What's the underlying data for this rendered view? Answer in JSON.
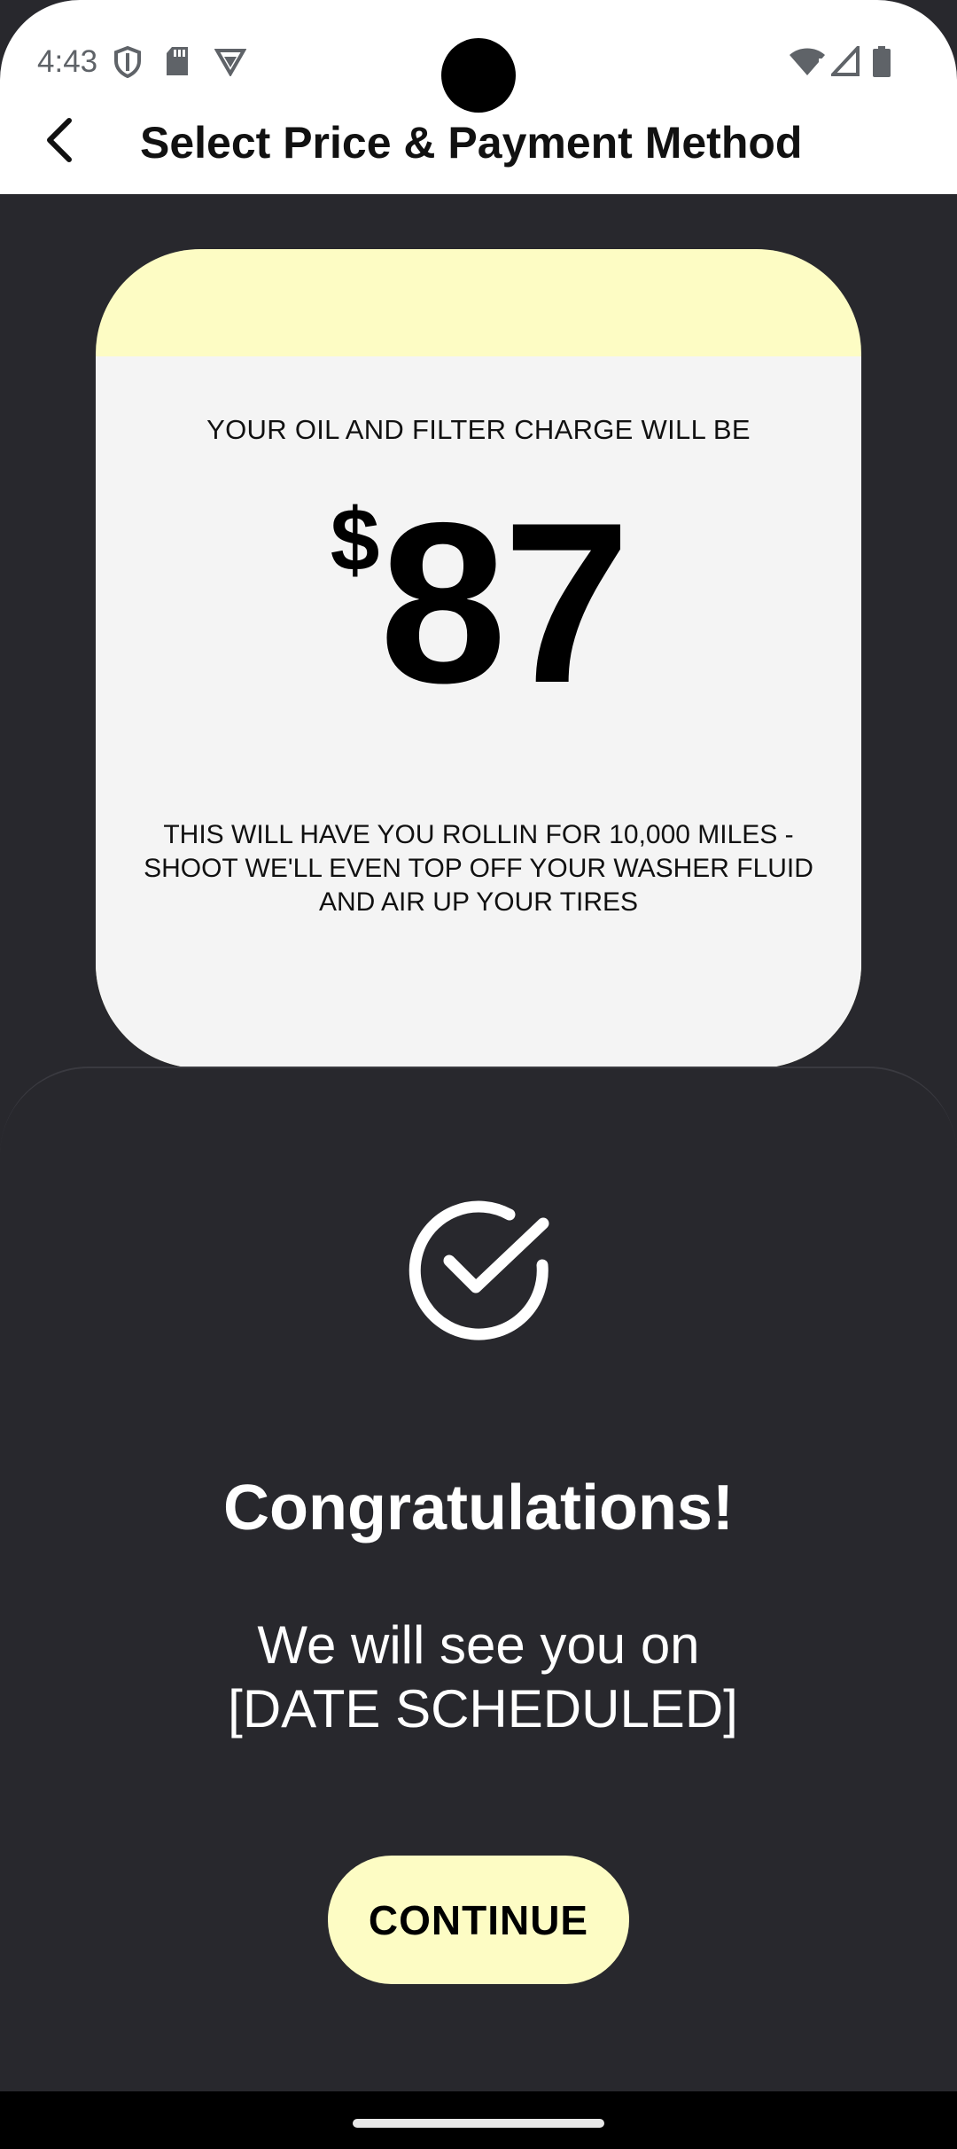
{
  "status_bar": {
    "time": "4:43",
    "left_icons": [
      "shield-icon",
      "sd-card-icon",
      "vpn-icon"
    ],
    "right_icons": [
      "wifi-alert-icon",
      "signal-icon",
      "battery-icon"
    ]
  },
  "app_bar": {
    "back_icon": "chevron-left-icon",
    "title": "Select Price & Payment Method"
  },
  "price_card": {
    "label": "YOUR OIL AND FILTER CHARGE WILL BE",
    "currency": "$",
    "amount": "87",
    "note": "THIS WILL HAVE YOU ROLLIN FOR 10,000 MILES - SHOOT WE'LL EVEN TOP OFF YOUR WASHER FLUID AND AIR UP YOUR TIRES"
  },
  "confirmation": {
    "icon": "check-circle-icon",
    "heading": "Congratulations!",
    "message_line1": "We will see you on",
    "message_line2": "[DATE SCHEDULED]",
    "continue_label": "CONTINUE"
  },
  "colors": {
    "accent": "#fdfcc4",
    "background": "#28282d",
    "card": "#f4f4f4"
  }
}
